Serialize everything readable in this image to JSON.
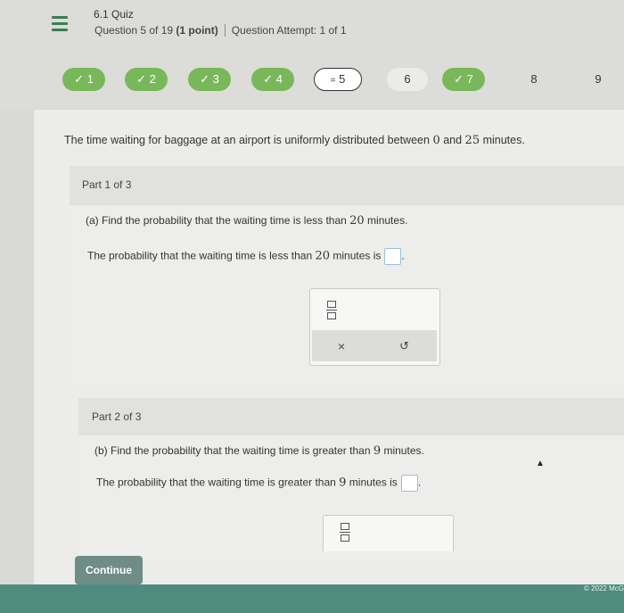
{
  "header": {
    "quiz_title": "6.1 Quiz",
    "question_prefix": "Question 5 of 19",
    "points": "(1 point)",
    "attempt_label": "Question Attempt:",
    "attempt_value": "1 of 1"
  },
  "question_nav": [
    {
      "label": "1",
      "status": "answered"
    },
    {
      "label": "2",
      "status": "answered"
    },
    {
      "label": "3",
      "status": "answered"
    },
    {
      "label": "4",
      "status": "answered"
    },
    {
      "label": "5",
      "status": "current"
    },
    {
      "label": "6",
      "status": "unanswered"
    },
    {
      "label": "7",
      "status": "answered"
    },
    {
      "label": "8",
      "status": "unanswered"
    },
    {
      "label": "9",
      "status": "unanswered"
    }
  ],
  "nav_icons": {
    "check": "✓",
    "current": "="
  },
  "stem": {
    "before": "The time waiting for baggage at an airport is uniformly distributed between",
    "low": "0",
    "between": "and",
    "high": "25",
    "after": "minutes."
  },
  "part1": {
    "label": "Part 1 of 3",
    "question_prefix": "(a) Find the probability that the waiting time is less than",
    "question_value": "20",
    "question_suffix": "minutes.",
    "answer_prefix": "The probability that the waiting time is less than",
    "answer_value": "20",
    "answer_suffix": "minutes is",
    "period": "."
  },
  "tools": {
    "clear": "×",
    "undo": "↺"
  },
  "part2": {
    "label": "Part 2 of 3",
    "question_prefix": "(b) Find the probability that the waiting time is greater than",
    "question_value": "9",
    "question_suffix": "minutes.",
    "answer_prefix": "The probability that the waiting time is greater than",
    "answer_value": "9",
    "answer_suffix": "minutes is",
    "period": "."
  },
  "continue_label": "Continue",
  "copyright": "© 2022 McG",
  "colors": {
    "accent_green": "#79b85a",
    "footer_teal": "#4f8c7f",
    "button": "#6f8c86"
  }
}
